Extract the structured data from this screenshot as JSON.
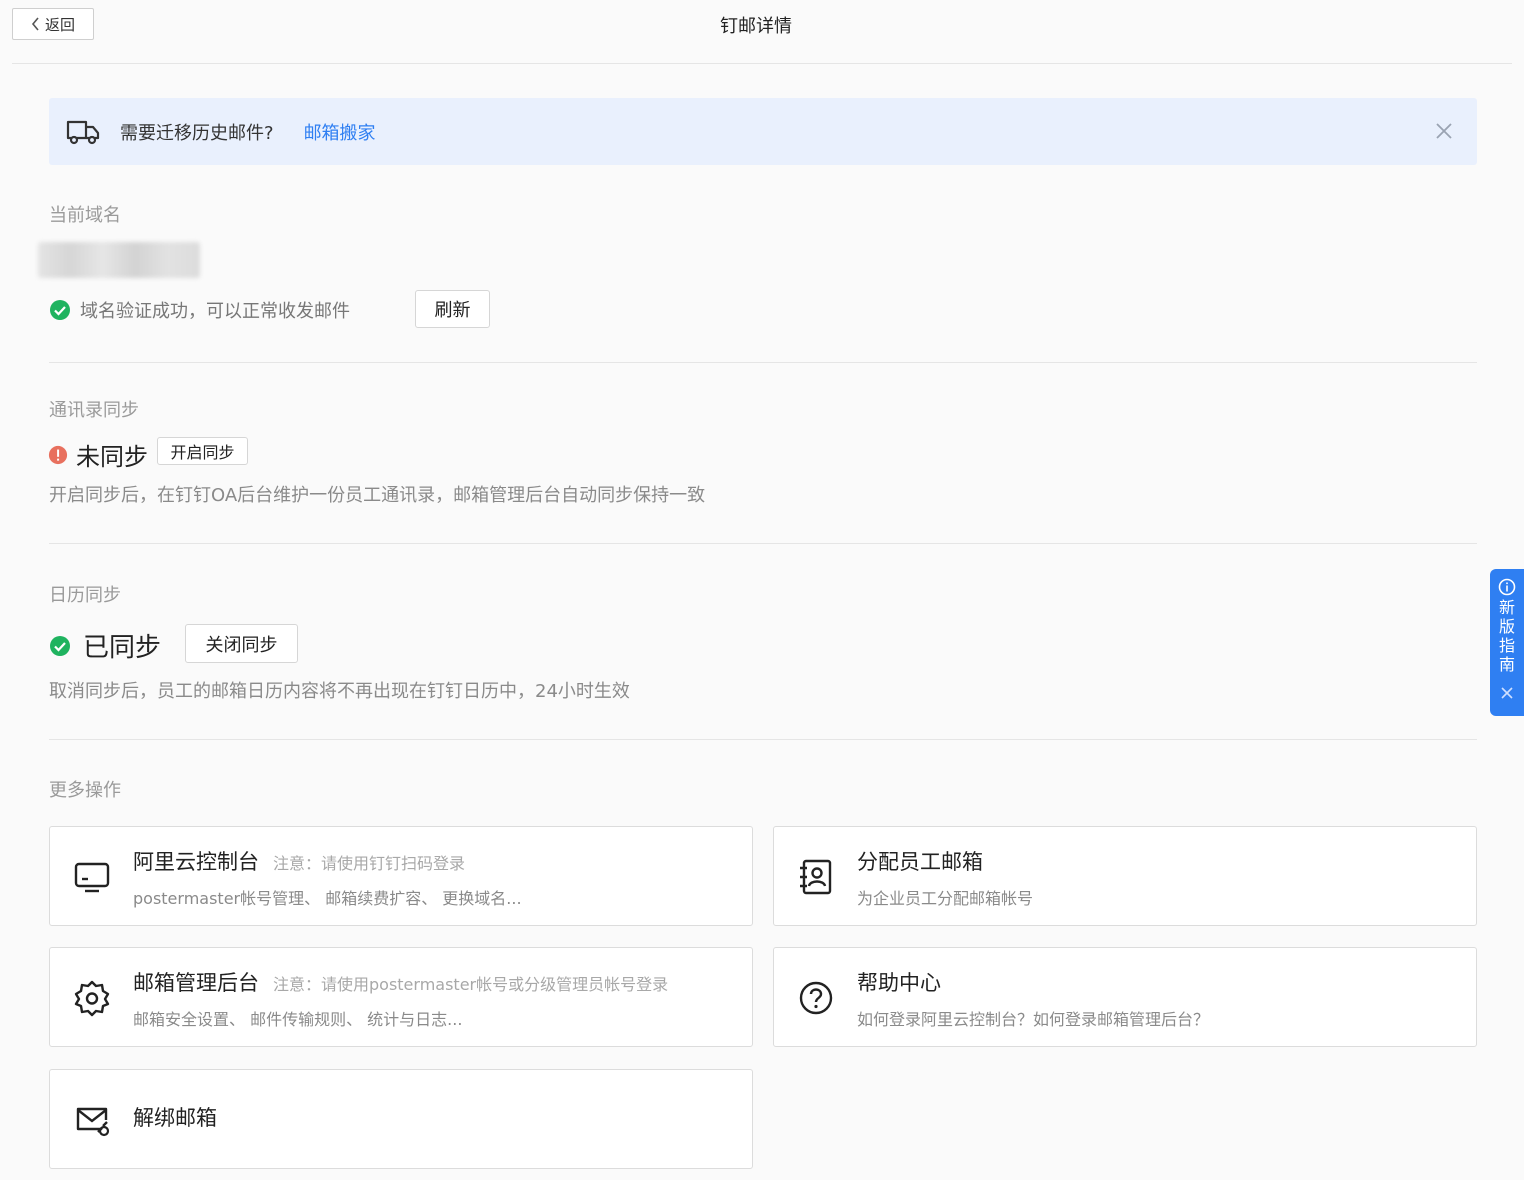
{
  "header": {
    "back_label": "返回",
    "title": "钉邮详情"
  },
  "banner": {
    "icon": "truck-icon",
    "text": "需要迁移历史邮件?",
    "link": "邮箱搬家",
    "close_icon": "close-icon"
  },
  "domain": {
    "label": "当前域名",
    "status_text": "域名验证成功，可以正常收发邮件",
    "refresh_label": "刷新"
  },
  "contacts_sync": {
    "label": "通讯录同步",
    "status": "未同步",
    "action_label": "开启同步",
    "description": "开启同步后，在钉钉OA后台维护一份员工通讯录，邮箱管理后台自动同步保持一致"
  },
  "calendar_sync": {
    "label": "日历同步",
    "status": "已同步",
    "action_label": "关闭同步",
    "description": "取消同步后，员工的邮箱日历内容将不再出现在钉钉日历中，24小时生效"
  },
  "more": {
    "label": "更多操作",
    "cards": [
      {
        "title": "阿里云控制台",
        "note": "注意：请使用钉钉扫码登录",
        "subtitle": "postermaster帐号管理、 邮箱续费扩容、 更换域名...",
        "icon": "monitor-icon"
      },
      {
        "title": "分配员工邮箱",
        "subtitle": "为企业员工分配邮箱帐号",
        "icon": "contact-book-icon"
      },
      {
        "title": "邮箱管理后台",
        "note": "注意：请使用postermaster帐号或分级管理员帐号登录",
        "subtitle": "邮箱安全设置、 邮件传输规则、 统计与日志...",
        "icon": "gear-icon"
      },
      {
        "title": "帮助中心",
        "subtitle": "如何登录阿里云控制台？如何登录邮箱管理后台？",
        "icon": "help-icon"
      },
      {
        "title": "解绑邮箱",
        "icon": "mail-unlink-icon"
      }
    ]
  },
  "guide": {
    "text": "新版指南"
  },
  "colors": {
    "accent": "#2f7ff2",
    "success": "#1fb35f",
    "warning": "#e8705e",
    "banner_bg": "#e9f0fd"
  }
}
